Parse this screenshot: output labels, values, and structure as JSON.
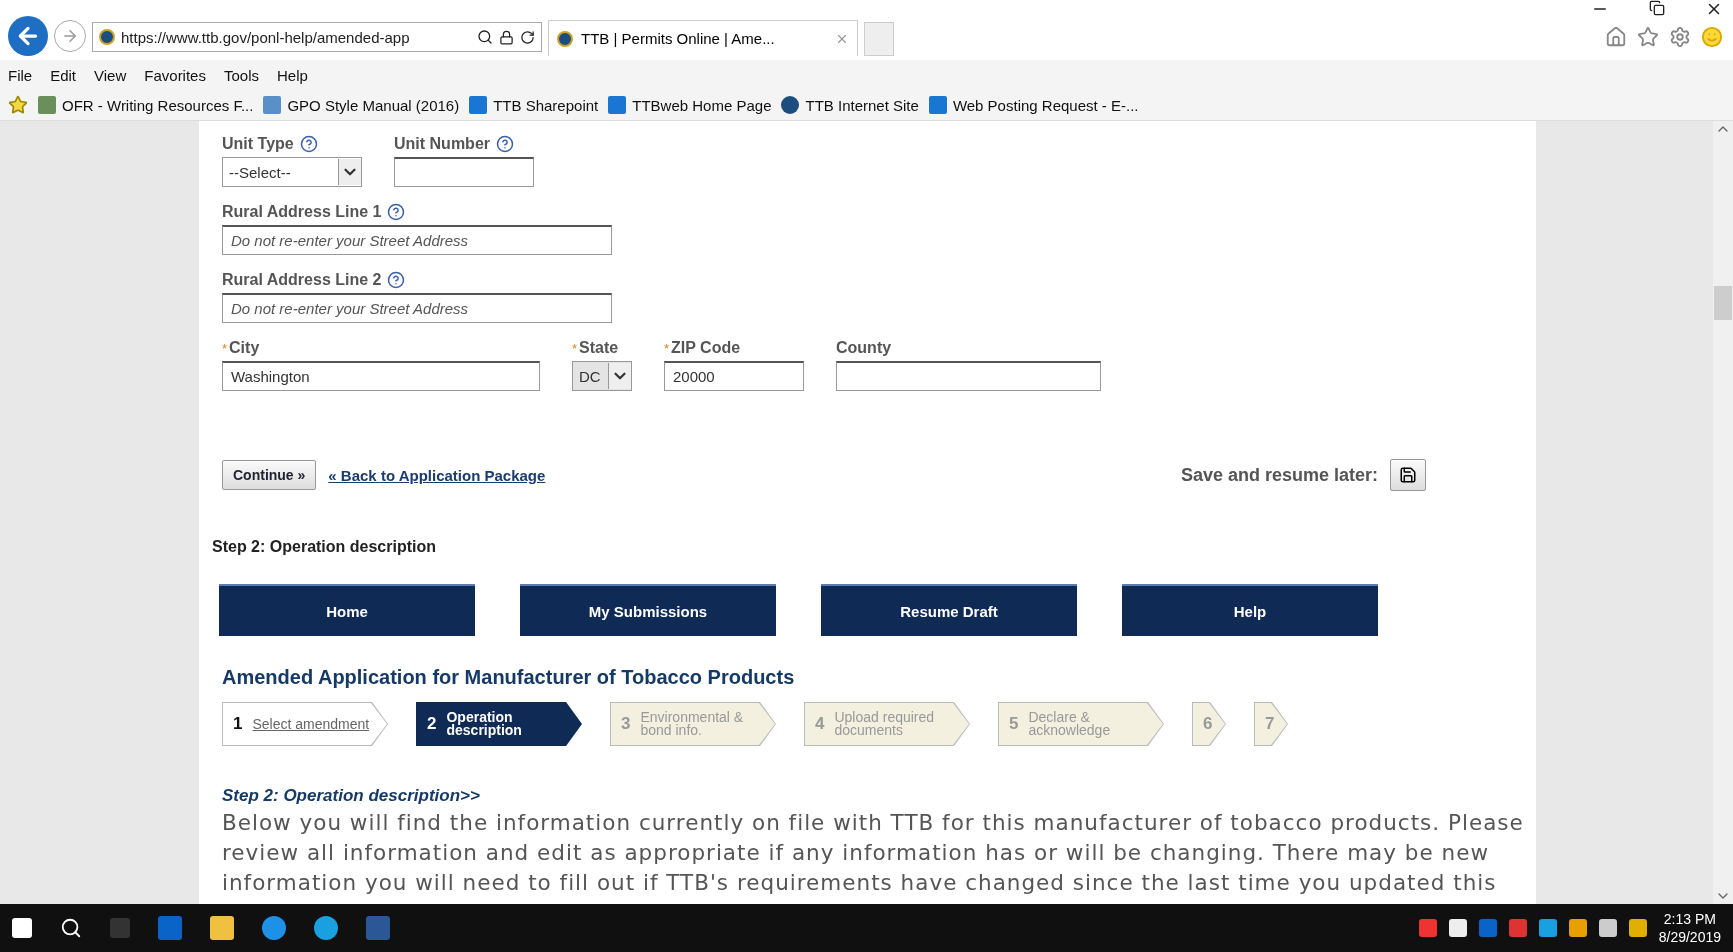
{
  "browser": {
    "address": "https://www.ttb.gov/ponl-help/amended-app",
    "tab_title": "TTB | Permits Online | Ame...",
    "menu": [
      "File",
      "Edit",
      "View",
      "Favorites",
      "Tools",
      "Help"
    ],
    "favorites": [
      "OFR - Writing Resources F...",
      "GPO Style Manual (2016)",
      "TTB Sharepoint",
      "TTBweb Home Page",
      "TTB Internet Site",
      "Web Posting Request - E-..."
    ]
  },
  "address_form": [
    {
      "fields": [
        {
          "label": "Unit Type",
          "kind": "select",
          "help": true,
          "value": "--Select--",
          "disabled": false
        },
        {
          "label": "Unit Number",
          "kind": "text",
          "help": true
        }
      ]
    },
    {
      "fields": [
        {
          "label": "Rural Address Line 1",
          "kind": "text",
          "help": true,
          "placeholder": "Do not re-enter your Street Address"
        }
      ]
    },
    {
      "fields": [
        {
          "label": "Rural Address Line 2",
          "kind": "text",
          "help": true,
          "placeholder": "Do not re-enter your Street Address"
        }
      ]
    },
    {
      "fields": [
        {
          "label": "City",
          "kind": "text",
          "required_mark": "*",
          "value": "Washington"
        },
        {
          "label": "State",
          "kind": "select",
          "required_mark": "*",
          "value": "DC",
          "disabled": true
        },
        {
          "label": "ZIP Code",
          "kind": "text",
          "required_mark": "*",
          "value": "20000"
        },
        {
          "label": "County",
          "kind": "text"
        }
      ]
    }
  ],
  "actions": {
    "continue": "Continue »",
    "back_link": "« Back to Application Package",
    "save_label": "Save and resume later:"
  },
  "step_caption": "Step 2: Operation description",
  "nav": [
    "Home",
    "My Submissions",
    "Resume Draft",
    "Help"
  ],
  "app_title": "Amended Application for Manufacturer of Tobacco Products",
  "steps": [
    {
      "number": "1",
      "label": "Select amendment",
      "selected": false,
      "available": true
    },
    {
      "number": "2",
      "label": "Operation description",
      "selected": true,
      "available": true
    },
    {
      "number": "3",
      "label": "Environmental & bond info.",
      "selected": false,
      "available": false
    },
    {
      "number": "4",
      "label": "Upload required documents",
      "selected": false,
      "available": false
    },
    {
      "number": "5",
      "label": "Declare & acknowledge",
      "selected": false,
      "available": false
    },
    {
      "number": "6",
      "selected": false,
      "available": false
    },
    {
      "number": "7",
      "selected": false,
      "available": false
    }
  ],
  "section_heading": "Step 2: Operation description>>",
  "intro": "Below you will find the information currently on file with TTB for this manufacturer of tobacco products. Please review all information and edit as appropriate if any information has or will be changing. There may be new information you will need to fill out if TTB's requirements have changed since the last time you updated this",
  "clock": {
    "time": "2:13 PM",
    "date": "8/29/2019"
  }
}
